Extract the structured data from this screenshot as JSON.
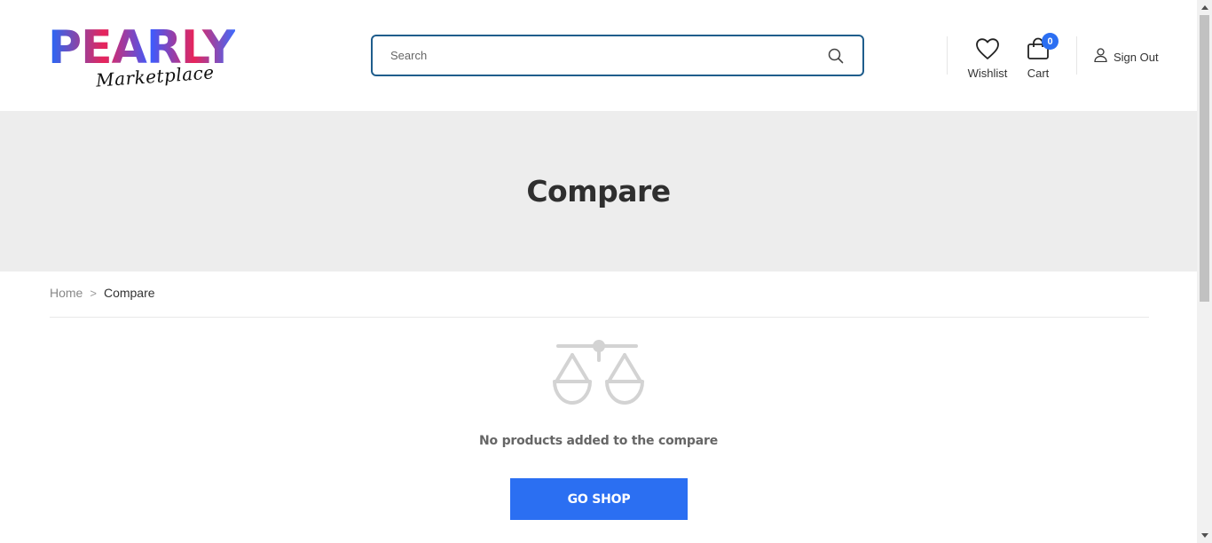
{
  "header": {
    "logo": {
      "word": "PEARLY",
      "script": "Marketplace"
    },
    "search": {
      "placeholder": "Search"
    },
    "wishlist_label": "Wishlist",
    "cart_label": "Cart",
    "cart_count": "0",
    "signout_label": "Sign Out"
  },
  "banner": {
    "title": "Compare"
  },
  "breadcrumb": {
    "home": "Home",
    "separator": ">",
    "current": "Compare"
  },
  "empty_state": {
    "icon": "balance-scale-icon",
    "message": "No products added to the compare",
    "button_label": "GO SHOP"
  },
  "colors": {
    "accent": "#2b6ff2",
    "search_border": "#1f5d8c",
    "banner_bg": "#ededed",
    "icon_gray": "#d3d3d3"
  }
}
